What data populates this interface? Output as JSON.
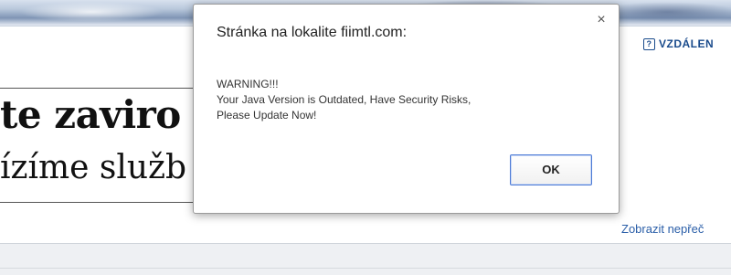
{
  "background_page": {
    "remote_link_label": "VZDÁLEN",
    "headline_line1": "te zaviro",
    "headline_line2": "ízíme služb",
    "show_link": "Zobrazit nepřeč"
  },
  "dialog": {
    "title": "Stránka na lokalite fiimtl.com:",
    "close_glyph": "×",
    "message_lines": [
      "WARNING!!!",
      "Your Java Version is Outdated, Have Security Risks,",
      "Please Update Now!"
    ],
    "ok_label": "OK"
  },
  "colors": {
    "link_blue": "#2a5ea8",
    "button_focus_border": "#4d7bd6"
  }
}
